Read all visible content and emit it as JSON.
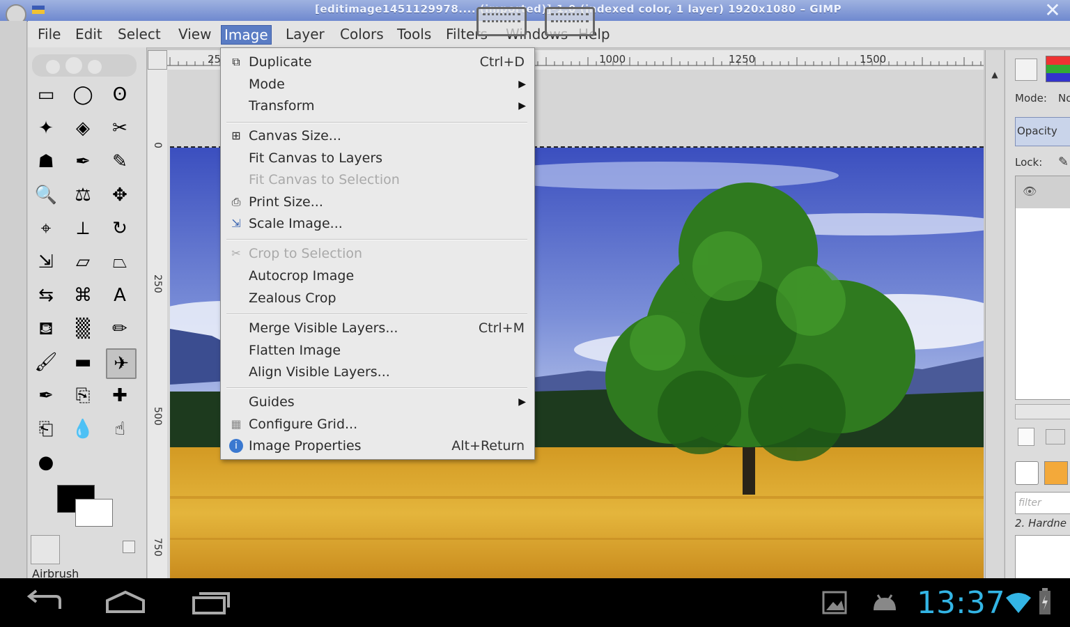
{
  "window": {
    "title": "[editimage1451129978.... (imported)]-1.0 (indexed color, 1 layer) 1920x1080 – GIMP",
    "close_glyph": "✕"
  },
  "menubar": [
    "File",
    "Edit",
    "Select",
    "View",
    "Image",
    "Layer",
    "Colors",
    "Tools",
    "Filters",
    "Windows",
    "Help"
  ],
  "active_menu": "Image",
  "image_menu": {
    "items": [
      {
        "label": "Duplicate",
        "shortcut": "Ctrl+D",
        "icon": "duplicate-icon",
        "enabled": true
      },
      {
        "label": "Mode",
        "submenu": true,
        "enabled": true
      },
      {
        "label": "Transform",
        "submenu": true,
        "enabled": true
      },
      {
        "label": "Canvas Size...",
        "icon": "canvas-size-icon",
        "enabled": true
      },
      {
        "label": "Fit Canvas to Layers",
        "enabled": true
      },
      {
        "label": "Fit Canvas to Selection",
        "enabled": false
      },
      {
        "label": "Print Size...",
        "icon": "print-size-icon",
        "enabled": true
      },
      {
        "label": "Scale Image...",
        "icon": "scale-image-icon",
        "enabled": true
      },
      {
        "label": "Crop to Selection",
        "icon": "crop-icon",
        "enabled": false
      },
      {
        "label": "Autocrop Image",
        "enabled": true
      },
      {
        "label": "Zealous Crop",
        "enabled": true
      },
      {
        "label": "Merge Visible Layers...",
        "shortcut": "Ctrl+M",
        "enabled": true
      },
      {
        "label": "Flatten Image",
        "enabled": true
      },
      {
        "label": "Align Visible Layers...",
        "enabled": true
      },
      {
        "label": "Guides",
        "submenu": true,
        "enabled": true
      },
      {
        "label": "Configure Grid...",
        "icon": "grid-icon",
        "enabled": true
      },
      {
        "label": "Image Properties",
        "shortcut": "Alt+Return",
        "icon": "info-icon",
        "enabled": true
      }
    ]
  },
  "ruler_top": [
    "25",
    "1000",
    "1250",
    "1500"
  ],
  "ruler_left": [
    "0",
    "250",
    "500",
    "750"
  ],
  "toolbox": {
    "tools": [
      "rect-select",
      "ellipse-select",
      "free-select",
      "fuzzy-select",
      "color-select",
      "scissors-select",
      "foreground-select",
      "paths",
      "color-picker",
      "zoom",
      "measure",
      "move",
      "align",
      "crop",
      "rotate",
      "scale",
      "shear",
      "perspective",
      "flip",
      "cage-transform",
      "text",
      "bucket-fill",
      "blend",
      "pencil",
      "paintbrush",
      "eraser",
      "airbrush",
      "ink",
      "clone",
      "heal",
      "perspective-clone",
      "blur",
      "smudge",
      "dodge-burn"
    ],
    "selected_tool": "airbrush",
    "tool_options_label": "Airbrush",
    "fg_color": "#000000",
    "bg_color": "#ffffff"
  },
  "dock": {
    "mode_label": "Mode:",
    "mode_value": "No",
    "opacity_label": "Opacity",
    "lock_label": "Lock:",
    "filter_placeholder": "filter",
    "brush_label": "2. Hardne"
  },
  "statusbar": {
    "clock": "13:37"
  },
  "colors": {
    "accent": "#5a7cc4",
    "clock": "#33b5e5"
  }
}
